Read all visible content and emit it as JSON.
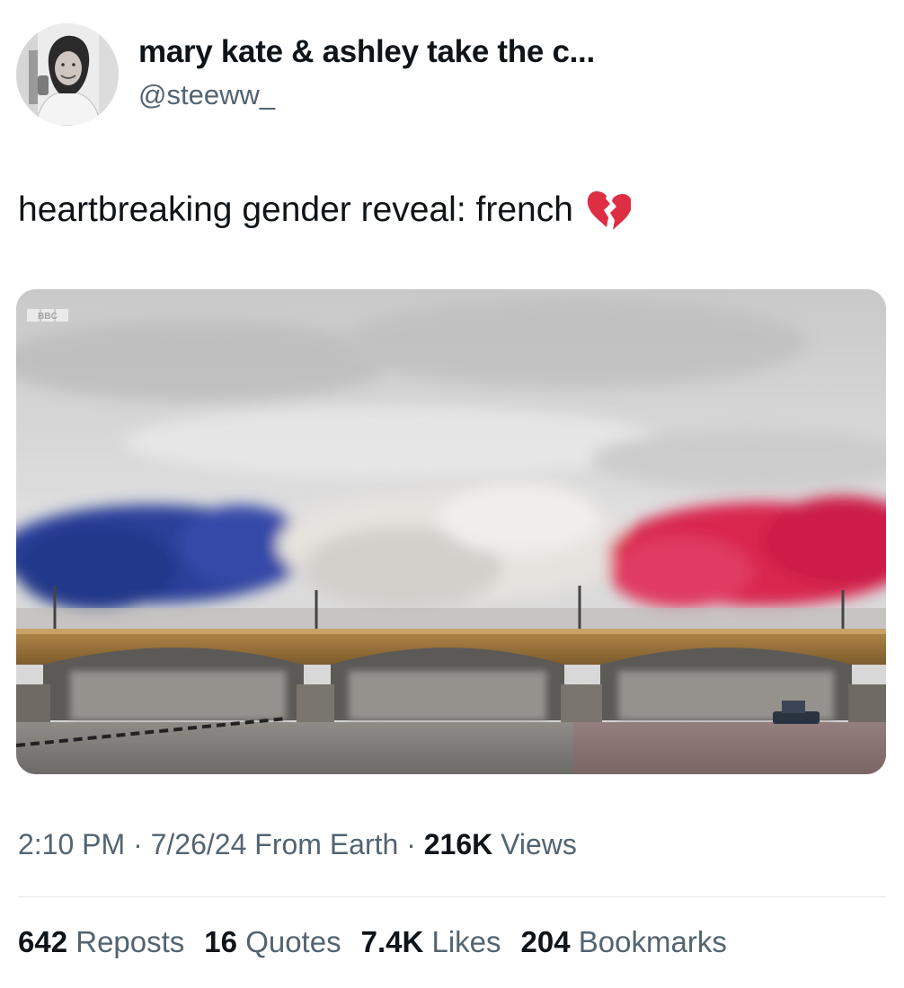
{
  "author": {
    "display_name": "mary kate & ashley take the c...",
    "handle": "@steeww_",
    "avatar_icon": "avatar-photo-icon"
  },
  "tweet": {
    "text": "heartbreaking gender reveal: french",
    "emoji_icon": "broken-heart-emoji-icon",
    "emoji_color": "#dd2e44"
  },
  "media": {
    "watermark": "BBC",
    "smoke_colors": [
      "#2a3f9a",
      "#e6e2de",
      "#d9264f"
    ]
  },
  "meta": {
    "time": "2:10 PM",
    "separator": "·",
    "date": "7/26/24",
    "source": "From Earth",
    "views_count": "216K",
    "views_label": "Views"
  },
  "stats": {
    "reposts_count": "642",
    "reposts_label": "Reposts",
    "quotes_count": "16",
    "quotes_label": "Quotes",
    "likes_count": "7.4K",
    "likes_label": "Likes",
    "bookmarks_count": "204",
    "bookmarks_label": "Bookmarks"
  }
}
